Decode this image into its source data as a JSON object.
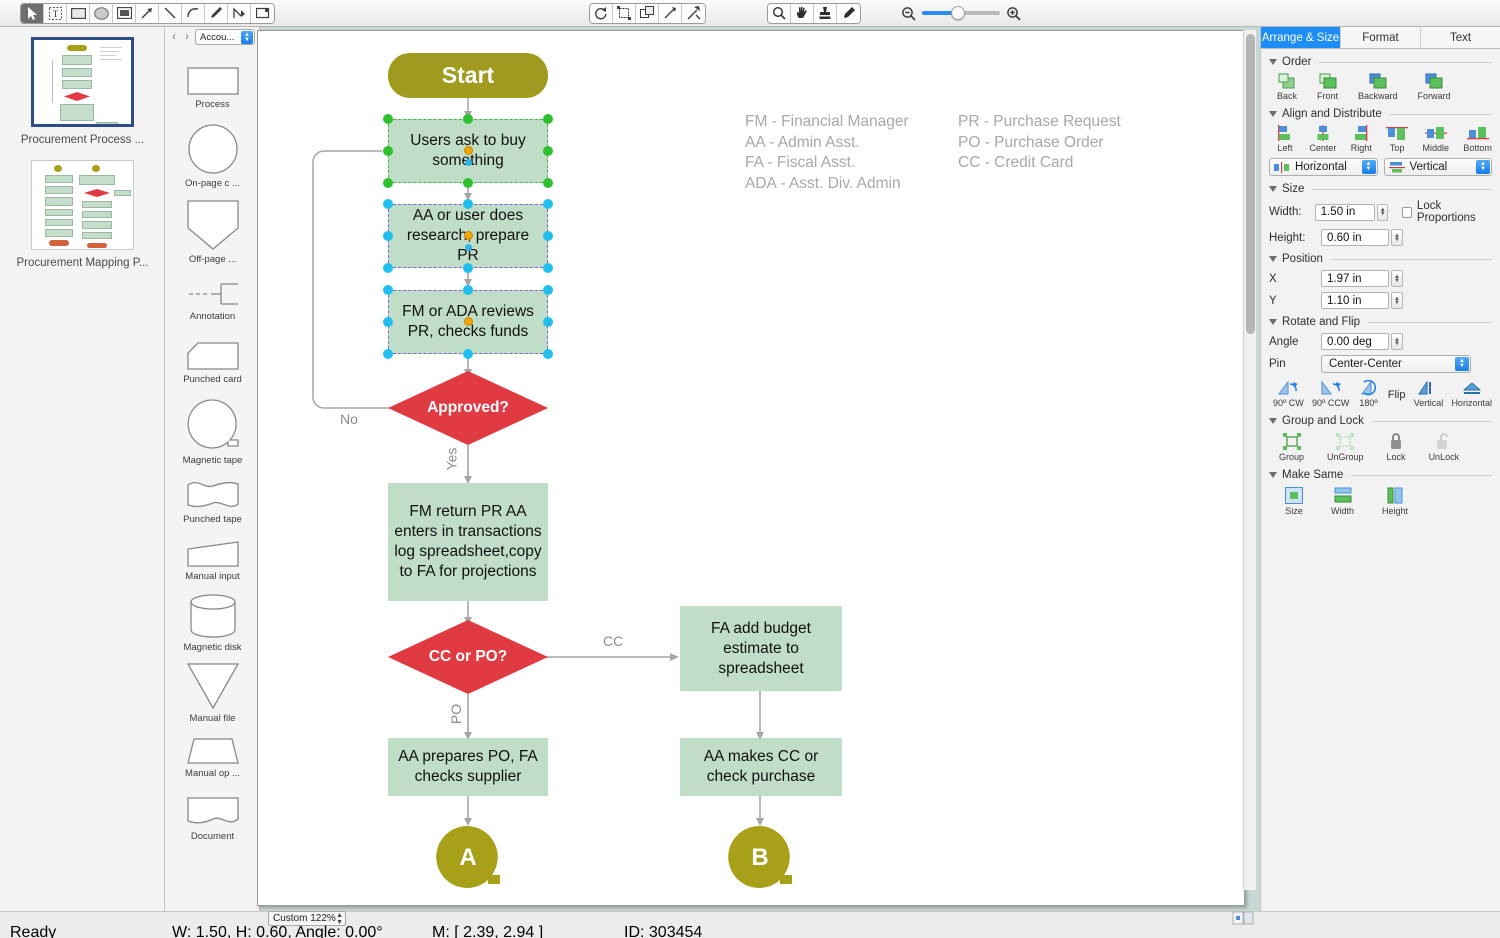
{
  "toolbar": {
    "tools": [
      {
        "name": "pointer-tool",
        "glyph": "arrow",
        "active": true
      },
      {
        "name": "text-tool",
        "glyph": "text"
      },
      {
        "name": "rectangle-tool",
        "glyph": "rect"
      },
      {
        "name": "ellipse-tool",
        "glyph": "ellipse"
      },
      {
        "name": "frame-tool",
        "glyph": "frame"
      },
      {
        "name": "line-arrow-tool",
        "glyph": "arrowline"
      },
      {
        "name": "line-tool",
        "glyph": "line"
      },
      {
        "name": "curve-tool",
        "glyph": "curve"
      },
      {
        "name": "pen-tool",
        "glyph": "pen"
      },
      {
        "name": "edit-points-tool",
        "glyph": "points"
      },
      {
        "name": "callout-tool",
        "glyph": "callout"
      }
    ],
    "tools2": [
      {
        "name": "rotate-tool",
        "glyph": "rotate"
      },
      {
        "name": "transform-tool",
        "glyph": "transform"
      },
      {
        "name": "duplicate-tool",
        "glyph": "duplicate"
      },
      {
        "name": "connector-tool",
        "glyph": "connector"
      },
      {
        "name": "smart-connector-tool",
        "glyph": "smartconn"
      }
    ],
    "tools3": [
      {
        "name": "zoom-tool",
        "glyph": "magnifier"
      },
      {
        "name": "hand-tool",
        "glyph": "hand"
      },
      {
        "name": "stamp-tool",
        "glyph": "stamp"
      },
      {
        "name": "eyedropper-tool",
        "glyph": "dropper"
      }
    ],
    "zoom_slider": {
      "name": "zoom-slider",
      "value": 44
    }
  },
  "documents": {
    "items": [
      {
        "title": "Procurement Process ...",
        "selected": true
      },
      {
        "title": "Procurement Mapping P...",
        "selected": false
      }
    ]
  },
  "shape_library": {
    "selected_library": "Accou...",
    "prev_label": "‹",
    "next_label": "›",
    "shapes": [
      {
        "label": "Process",
        "glyph": "rectangle"
      },
      {
        "label": "On-page c ...",
        "glyph": "circle"
      },
      {
        "label": "Off-page  ...",
        "glyph": "offpage"
      },
      {
        "label": "Annotation",
        "glyph": "annotation"
      },
      {
        "label": "Punched card",
        "glyph": "punchedcard"
      },
      {
        "label": "Magnetic tape",
        "glyph": "magtape"
      },
      {
        "label": "Punched tape",
        "glyph": "punchedtape"
      },
      {
        "label": "Manual input",
        "glyph": "manualinput"
      },
      {
        "label": "Magnetic disk",
        "glyph": "magdisk"
      },
      {
        "label": "Manual file",
        "glyph": "manualfile"
      },
      {
        "label": "Manual op ...",
        "glyph": "manualop"
      },
      {
        "label": "Document",
        "glyph": "document"
      }
    ]
  },
  "diagram": {
    "colors": {
      "process_fill": "#c0ddc8",
      "terminator_fill": "#a09a1e",
      "decision_fill": "#e03a43",
      "connector": "#a6a6a6",
      "legend_text": "#a8a8a8",
      "handle_primary": "#2ec02e",
      "handle_secondary": "#21bff0"
    },
    "nodes": [
      {
        "id": "start",
        "type": "terminator",
        "text": "Start"
      },
      {
        "id": "n1",
        "type": "process",
        "text": "Users ask to buy something",
        "selected": "primary"
      },
      {
        "id": "n2",
        "type": "process",
        "text": "AA or user does research, prepare PR",
        "selected": "secondary"
      },
      {
        "id": "n3",
        "type": "process",
        "text": "FM or ADA reviews PR, checks funds",
        "selected": "secondary"
      },
      {
        "id": "d1",
        "type": "decision",
        "text": "Approved?"
      },
      {
        "id": "n4",
        "type": "process",
        "text": "FM return PR AA enters in transactions log spreadsheet,copy to FA for projections"
      },
      {
        "id": "d2",
        "type": "decision",
        "text": "CC or PO?"
      },
      {
        "id": "n5",
        "type": "process",
        "text": "FA add budget estimate to spreadsheet"
      },
      {
        "id": "n6",
        "type": "process",
        "text": "AA prepares PO, FA checks supplier"
      },
      {
        "id": "n7",
        "type": "process",
        "text": "AA makes CC or check purchase"
      },
      {
        "id": "refA",
        "type": "connector-ref",
        "text": "A"
      },
      {
        "id": "refB",
        "type": "connector-ref",
        "text": "B"
      }
    ],
    "edge_labels": {
      "no": "No",
      "yes": "Yes",
      "cc": "CC",
      "po": "PO"
    },
    "legend_left": "FM - Financial Manager\nAA - Admin Asst.\nFA - Fiscal Asst.\nADA - Asst. Div. Admin",
    "legend_right": "PR - Purchase Request\nPO - Purchase Order\nCC - Credit Card"
  },
  "inspector": {
    "tabs": [
      {
        "label": "Arrange & Size",
        "active": true
      },
      {
        "label": "Format",
        "active": false
      },
      {
        "label": "Text",
        "active": false
      }
    ],
    "order": {
      "title": "Order",
      "buttons": [
        {
          "label": "Back",
          "name": "order-back"
        },
        {
          "label": "Front",
          "name": "order-front"
        },
        {
          "label": "Backward",
          "name": "order-backward"
        },
        {
          "label": "Forward",
          "name": "order-forward"
        }
      ]
    },
    "align": {
      "title": "Align and Distribute",
      "buttons": [
        {
          "label": "Left",
          "name": "align-left"
        },
        {
          "label": "Center",
          "name": "align-center"
        },
        {
          "label": "Right",
          "name": "align-right"
        },
        {
          "label": "Top",
          "name": "align-top"
        },
        {
          "label": "Middle",
          "name": "align-middle"
        },
        {
          "label": "Bottom",
          "name": "align-bottom"
        }
      ],
      "distribute_horizontal": "Horizontal",
      "distribute_vertical": "Vertical"
    },
    "size": {
      "title": "Size",
      "width_label": "Width:",
      "width_value": "1.50 in",
      "height_label": "Height:",
      "height_value": "0.60 in",
      "lock_proportions_label": "Lock Proportions",
      "lock_proportions_checked": false
    },
    "position": {
      "title": "Position",
      "x_label": "X",
      "x_value": "1.97 in",
      "y_label": "Y",
      "y_value": "1.10 in"
    },
    "rotate": {
      "title": "Rotate and Flip",
      "angle_label": "Angle",
      "angle_value": "0.00 deg",
      "pin_label": "Pin",
      "pin_value": "Center-Center",
      "buttons": [
        {
          "label": "90º CW",
          "name": "rotate-90-cw"
        },
        {
          "label": "90º CCW",
          "name": "rotate-90-ccw"
        },
        {
          "label": "180º",
          "name": "rotate-180"
        }
      ],
      "flip_label": "Flip",
      "flip_buttons": [
        {
          "label": "Vertical",
          "name": "flip-vertical"
        },
        {
          "label": "Horizontal",
          "name": "flip-horizontal"
        }
      ]
    },
    "group": {
      "title": "Group and Lock",
      "buttons": [
        {
          "label": "Group",
          "name": "group"
        },
        {
          "label": "UnGroup",
          "name": "ungroup"
        },
        {
          "label": "Lock",
          "name": "lock"
        },
        {
          "label": "UnLock",
          "name": "unlock"
        }
      ]
    },
    "makesame": {
      "title": "Make Same",
      "buttons": [
        {
          "label": "Size",
          "name": "make-same-size"
        },
        {
          "label": "Width",
          "name": "make-same-width"
        },
        {
          "label": "Height",
          "name": "make-same-height"
        }
      ]
    }
  },
  "statusbar": {
    "ready": "Ready",
    "dimensions": "W: 1.50,  H: 0.60,  Angle: 0.00°",
    "mouse": "M: [ 2.39, 2.94 ]",
    "id": "ID: 303454",
    "zoom": "Custom 122%"
  }
}
